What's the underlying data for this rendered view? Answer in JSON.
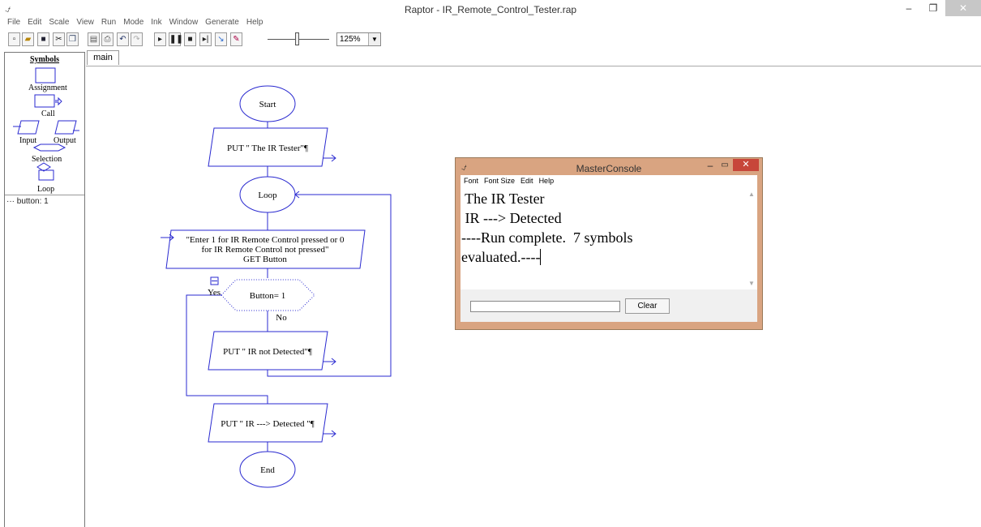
{
  "window": {
    "title": "Raptor - IR_Remote_Control_Tester.rap",
    "minimize": "–",
    "maximize": "❐",
    "close": "✕"
  },
  "menu": [
    "File",
    "Edit",
    "Scale",
    "View",
    "Run",
    "Mode",
    "Ink",
    "Window",
    "Generate",
    "Help"
  ],
  "toolbar": {
    "zoom_value": "125%"
  },
  "palette": {
    "title": "Symbols",
    "assignment": "Assignment",
    "call": "Call",
    "input": "Input",
    "output": "Output",
    "selection": "Selection",
    "loop": "Loop"
  },
  "variables": {
    "item": "button: 1"
  },
  "tabs": {
    "main": "main"
  },
  "flowchart": {
    "start": "Start",
    "put1": "PUT \" The IR Tester\"¶",
    "loop": "Loop",
    "input_line1": "\"Enter 1 for IR Remote Control pressed or 0",
    "input_line2": "for IR Remote Control not pressed\"",
    "input_line3": "GET Button",
    "condition": "Button= 1",
    "yes": "Yes",
    "no": "No",
    "put2": "PUT \" IR not Detected\"¶",
    "put3": "PUT \" IR ---> Detected \"¶",
    "end": "End"
  },
  "console": {
    "title": "MasterConsole",
    "menu": [
      "Font",
      "Font Size",
      "Edit",
      "Help"
    ],
    "lines": [
      " The IR Tester",
      " IR ---> Detected",
      "----Run complete.  7 symbols",
      "evaluated.----"
    ],
    "clear_label": "Clear"
  },
  "colors": {
    "flow_stroke": "#2a2ad0",
    "console_frame": "#d9a481",
    "console_close": "#c7463a"
  }
}
